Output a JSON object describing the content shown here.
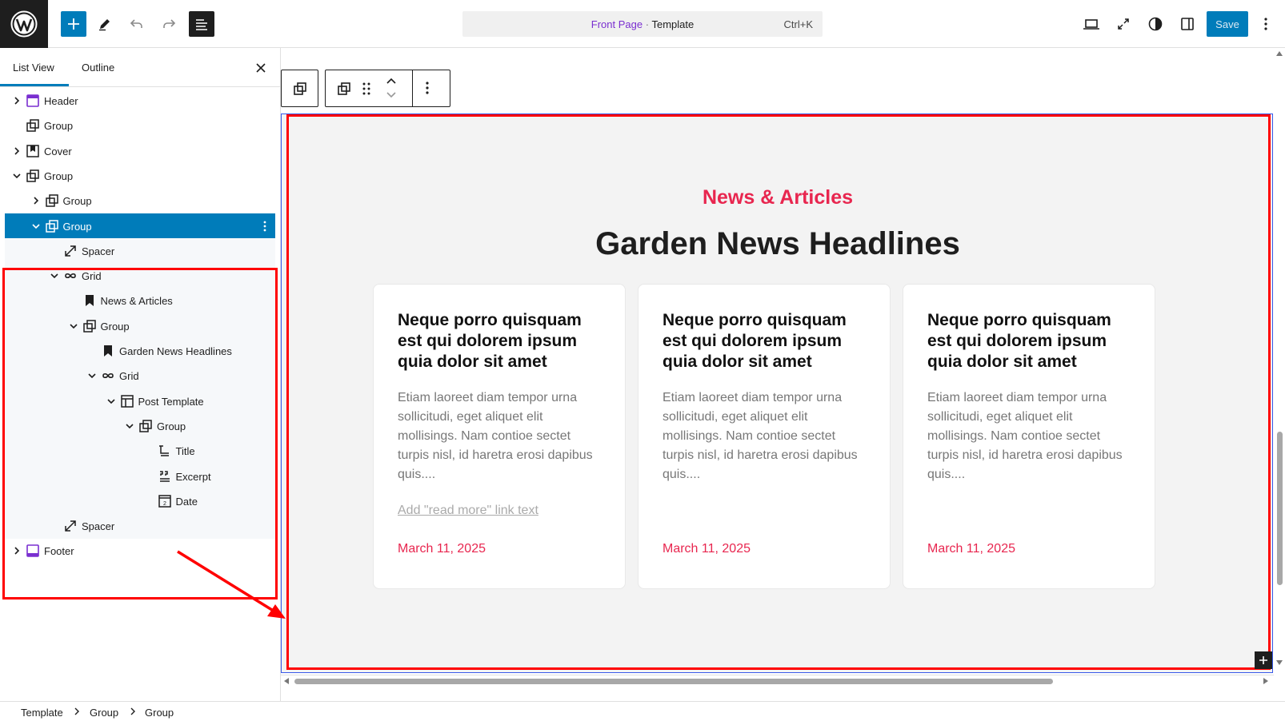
{
  "app": {
    "logo_icon": "wordpress-logo",
    "accent_color": "#007cba"
  },
  "toolbar": {
    "add_icon": "plus-icon",
    "edit_icon": "pencil-icon",
    "undo_icon": "undo-icon",
    "redo_icon": "redo-icon",
    "listview_icon": "list-view-icon",
    "command": {
      "page": "Front Page",
      "separator": "·",
      "type": "Template",
      "shortcut": "Ctrl+K"
    },
    "save_label": "Save"
  },
  "sidebar": {
    "tabs": [
      {
        "label": "List View",
        "active": true
      },
      {
        "label": "Outline",
        "active": false
      }
    ],
    "tree": [
      {
        "label": "Header",
        "icon": "header-icon",
        "expanded": false,
        "has_children": true
      },
      {
        "label": "Group",
        "icon": "group-icon",
        "has_children": false
      },
      {
        "label": "Cover",
        "icon": "cover-icon",
        "expanded": false,
        "has_children": true
      },
      {
        "label": "Group",
        "icon": "group-icon",
        "expanded": true,
        "has_children": true
      },
      {
        "label": "Group",
        "icon": "group-icon",
        "expanded": false,
        "has_children": true
      },
      {
        "label": "Group",
        "icon": "group-icon",
        "expanded": true,
        "has_children": true,
        "selected": true
      },
      {
        "label": "Spacer",
        "icon": "spacer-icon",
        "has_children": false
      },
      {
        "label": "Grid",
        "icon": "grid-icon",
        "expanded": true,
        "has_children": true
      },
      {
        "label": "News & Articles",
        "icon": "bookmark-icon",
        "has_children": false
      },
      {
        "label": "Group",
        "icon": "group-icon",
        "expanded": true,
        "has_children": true
      },
      {
        "label": "Garden News Headlines",
        "icon": "bookmark-icon",
        "has_children": false
      },
      {
        "label": "Grid",
        "icon": "grid-icon",
        "expanded": true,
        "has_children": true
      },
      {
        "label": "Post Template",
        "icon": "post-template-icon",
        "expanded": true,
        "has_children": true
      },
      {
        "label": "Group",
        "icon": "group-icon",
        "expanded": true,
        "has_children": true
      },
      {
        "label": "Title",
        "icon": "title-icon",
        "has_children": false
      },
      {
        "label": "Excerpt",
        "icon": "excerpt-icon",
        "has_children": false
      },
      {
        "label": "Date",
        "icon": "date-icon",
        "has_children": false
      },
      {
        "label": "Spacer",
        "icon": "spacer-icon",
        "has_children": false
      },
      {
        "label": "Footer",
        "icon": "footer-icon",
        "expanded": false,
        "has_children": true
      }
    ]
  },
  "canvas": {
    "eyebrow": "News & Articles",
    "headline": "Garden News Headlines",
    "accent_color": "#e8264f",
    "cards": [
      {
        "title": "Neque porro quisquam est qui dolorem ipsum quia dolor sit amet",
        "excerpt": "Etiam laoreet diam tempor urna sollicitudi, eget aliquet elit mollisings. Nam contioe sectet turpis nisl, id haretra erosi dapibus quis....",
        "read_more": "Add \"read more\" link text",
        "date": "March 11, 2025"
      },
      {
        "title": "Neque porro quisquam est qui dolorem ipsum quia dolor sit amet",
        "excerpt": "Etiam laoreet diam tempor urna sollicitudi, eget aliquet elit mollisings. Nam contioe sectet turpis nisl, id haretra erosi dapibus quis....",
        "date": "March 11, 2025"
      },
      {
        "title": "Neque porro quisquam est qui dolorem ipsum quia dolor sit amet",
        "excerpt": "Etiam laoreet diam tempor urna sollicitudi, eget aliquet elit mollisings. Nam contioe sectet turpis nisl, id haretra erosi dapibus quis....",
        "date": "March 11, 2025"
      }
    ]
  },
  "breadcrumbs": [
    "Template",
    "Group",
    "Group"
  ],
  "annotation_color": "#ff0000"
}
